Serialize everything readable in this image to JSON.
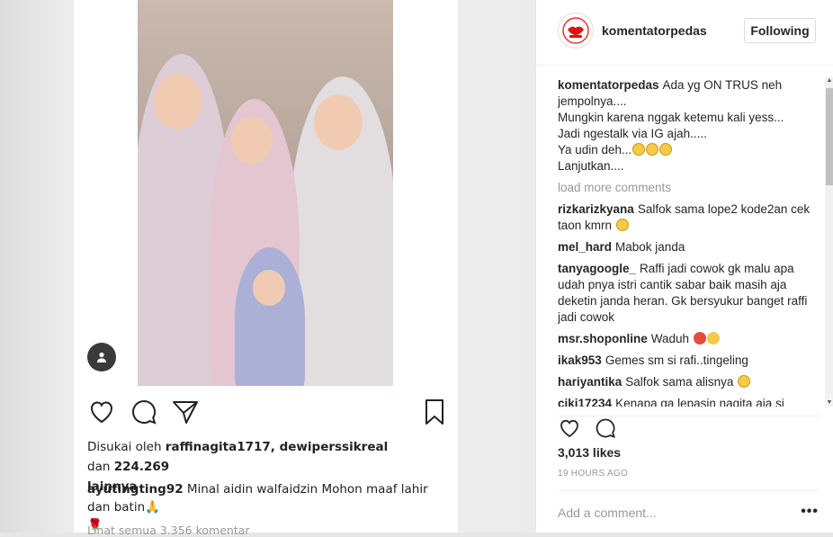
{
  "inner_post": {
    "liked_prefix": "Disukai oleh",
    "liked_users": "raffinagita1717, dewiperssikreal",
    "liked_mid": "dan",
    "liked_count": "224.269",
    "liked_suffix": "lainnya",
    "caption_user": "ayutingting92",
    "caption_text": "Minal aidin walfaidzin Mohon maaf lahir dan batin🙏",
    "caption_line2": "🌹",
    "view_all": "Lihat semua 3.356 komentar"
  },
  "panel": {
    "username": "komentatorpedas",
    "follow_label": "Following",
    "load_more": "load more comments",
    "caption": {
      "user": "komentatorpedas",
      "lines": [
        "Ada yg ON TRUS neh",
        "jempolnya....",
        "Mungkin karena nggak ketemu kali yess...",
        "Jadi ngestalk via IG ajah.....",
        "Ya udin deh...",
        "Lanjutkan...."
      ]
    },
    "comments": [
      {
        "user": "rizkarizkyana",
        "text": "Salfok sama lope2 kode2an cek taon kmrn"
      },
      {
        "user": "mel_hard",
        "text": "Mabok janda"
      },
      {
        "user": "tanyagoogle_",
        "text": "Raffi jadi cowok gk malu apa udah pnya istri cantik sabar baik masih aja deketin janda heran. Gk bersyukur banget raffi jadi cowok"
      },
      {
        "user": "msr.shoponline",
        "text": "Waduh"
      },
      {
        "user": "ikak953",
        "text": "Gemes sm si rafi..tingeling"
      },
      {
        "user": "hariyantika",
        "text": "Salfok sama alisnya"
      },
      {
        "user": "ciki17234",
        "text": "Kenapa ga lepasin nagita aja si"
      }
    ],
    "likes": "3,013 likes",
    "time": "19 HOURS AGO",
    "add_comment_placeholder": "Add a comment...",
    "more": "•••"
  }
}
